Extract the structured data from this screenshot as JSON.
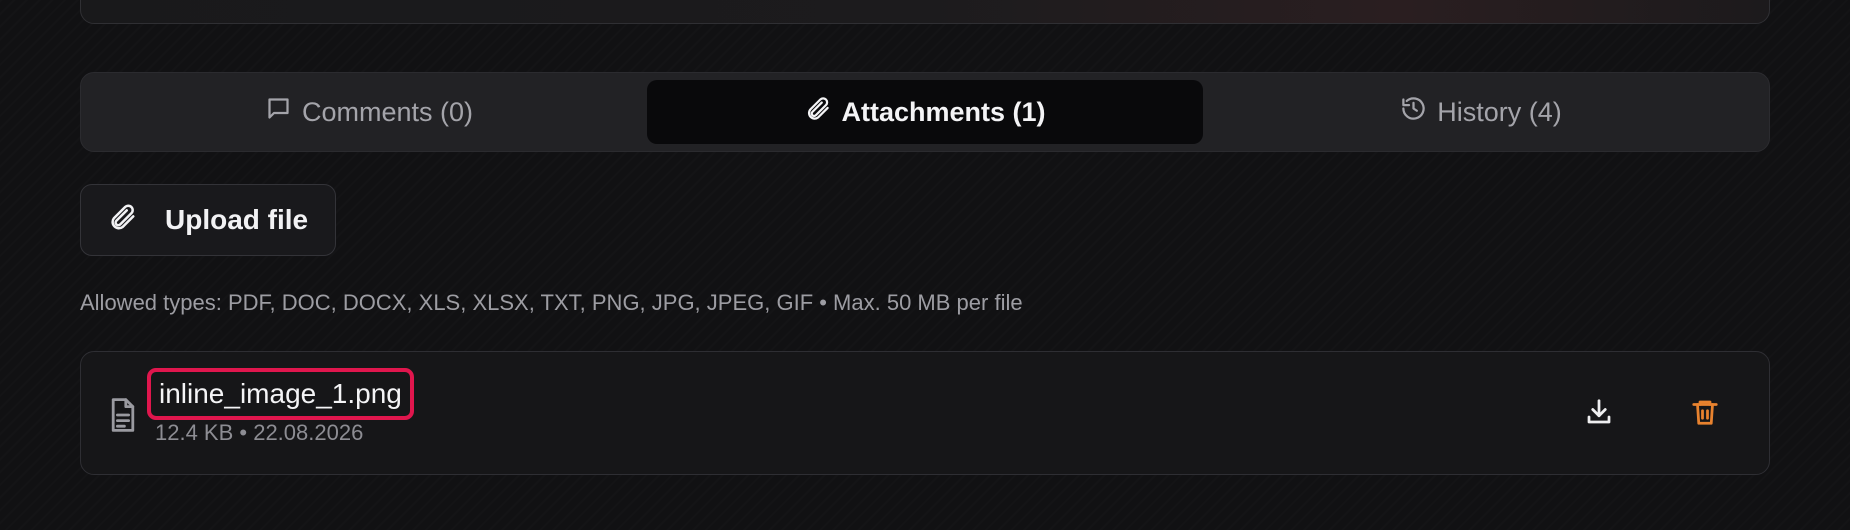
{
  "tabs": {
    "comments": {
      "label": "Comments (0)",
      "icon": "message-square-icon"
    },
    "attachments": {
      "label": "Attachments (1)",
      "icon": "paperclip-icon",
      "active": true
    },
    "history": {
      "label": "History (4)",
      "icon": "history-icon"
    }
  },
  "upload": {
    "label": "Upload file",
    "icon": "paperclip-icon"
  },
  "allowed_types_text": "Allowed types: PDF, DOC, DOCX, XLS, XLSX, TXT, PNG, JPG, JPEG, GIF • Max. 50 MB per file",
  "attachments": [
    {
      "name": "inline_image_1.png",
      "meta": "12.4 KB • 22.08.2026",
      "icon": "file-text-icon",
      "actions": [
        {
          "name": "download",
          "icon": "download-icon",
          "color": "#eeeeef"
        },
        {
          "name": "delete",
          "icon": "trash-icon",
          "color": "#e8822e"
        }
      ]
    }
  ],
  "colors": {
    "background": "#111113",
    "active_tab": "#09090b",
    "highlight_border": "#e0164d",
    "delete_accent": "#e8822e"
  }
}
